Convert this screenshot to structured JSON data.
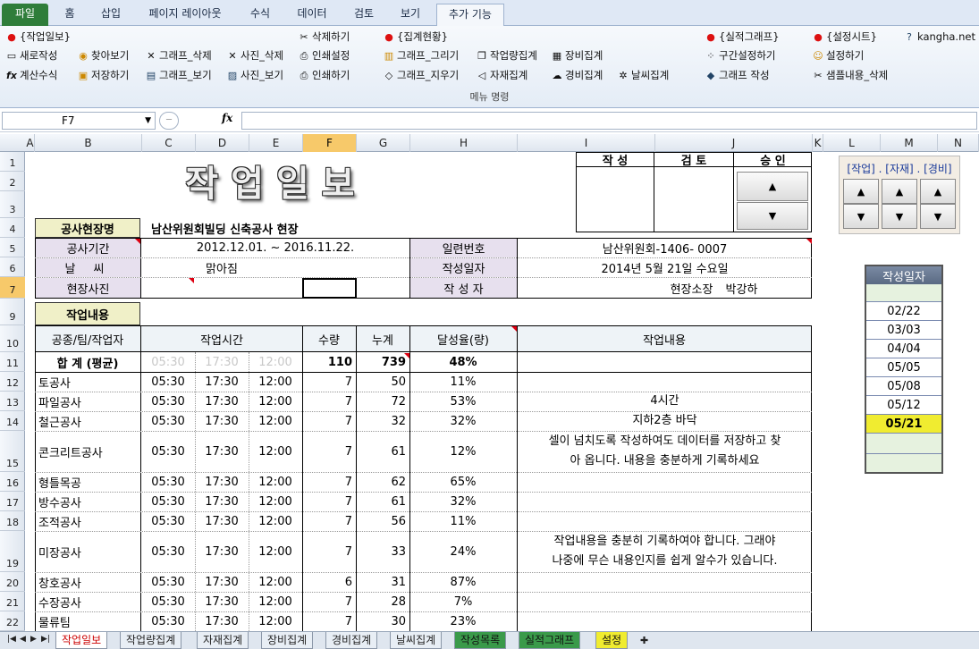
{
  "ribbon_tabs": [
    "파일",
    "홈",
    "삽입",
    "페이지 레이아웃",
    "수식",
    "데이터",
    "검토",
    "보기",
    "추가 기능"
  ],
  "ribbon": {
    "col1": [
      "{작업일보}",
      "새로작성",
      "계산수식"
    ],
    "col2": [
      "찾아보기",
      "저장하기"
    ],
    "col3": [
      "그래프_삭제",
      "그래프_보기"
    ],
    "col4": [
      "사진_삭제",
      "사진_보기"
    ],
    "col5": [
      "삭제하기",
      "인쇄설정",
      "인쇄하기"
    ],
    "col6": [
      "{집계현황}",
      "그래프_그리기",
      "그래프_지우기"
    ],
    "col7": [
      "작업량집계",
      "자재집계"
    ],
    "col8": [
      "장비집계",
      "경비집계"
    ],
    "col9": [
      "날씨집계"
    ],
    "col10": [
      "{실적그래프}",
      "구간설정하기",
      "그래프 작성"
    ],
    "col11": [
      "{설정시트}",
      "설정하기",
      "샘플내용_삭제"
    ],
    "site": "kangha.net",
    "group_label": "메뉴 명령"
  },
  "formula_bar": {
    "name_box": "F7",
    "fx": "fx",
    "value": ""
  },
  "columns": [
    "A",
    "B",
    "C",
    "D",
    "E",
    "F",
    "G",
    "H",
    "I",
    "J",
    "K",
    "L",
    "M",
    "N"
  ],
  "rows": [
    "1",
    "2",
    "3",
    "4",
    "5",
    "6",
    "7",
    "9",
    "10",
    "11",
    "12",
    "13",
    "14",
    "15",
    "16",
    "17",
    "18",
    "19",
    "20",
    "21",
    "22"
  ],
  "sheet": {
    "title": "작업일보",
    "approval": {
      "write": "작 성",
      "review": "검 토",
      "approve": "승 인"
    },
    "site_label": "공사현장명",
    "site_value": "남산위원회빌딩 신축공사 현장",
    "period_label": "공사기간",
    "period_value": "2012.12.01. ~ 2016.11.22.",
    "weather_label": "날 씨",
    "weather_value": "맑아짐",
    "photo_label": "현장사진",
    "serial_label": "일련번호",
    "serial_value": "남산위원회-1406- 0007",
    "date_label": "작성일자",
    "date_value": "2014년 5월 21일 수요일",
    "writer_label": "작 성 자",
    "writer_value": "현장소장 박강하",
    "work_label": "작업내용",
    "table_headers": {
      "trade": "공종/팀/작업자",
      "time": "작업시간",
      "qty": "수량",
      "cum": "누계",
      "rate": "달성율(량)",
      "content": "작업내용"
    },
    "total": {
      "label": "합 계 (평균)",
      "t1": "05:30",
      "t2": "17:30",
      "t3": "12:00",
      "qty": "110",
      "cum": "739",
      "rate": "48%"
    },
    "rows": [
      {
        "name": "토공사",
        "t1": "05:30",
        "t2": "17:30",
        "t3": "12:00",
        "qty": "7",
        "cum": "50",
        "rate": "11%",
        "content": ""
      },
      {
        "name": "파일공사",
        "t1": "05:30",
        "t2": "17:30",
        "t3": "12:00",
        "qty": "7",
        "cum": "72",
        "rate": "53%",
        "content": "4시간"
      },
      {
        "name": "철근공사",
        "t1": "05:30",
        "t2": "17:30",
        "t3": "12:00",
        "qty": "7",
        "cum": "32",
        "rate": "32%",
        "content": "지하2층 바닥"
      },
      {
        "name": "콘크리트공사",
        "t1": "05:30",
        "t2": "17:30",
        "t3": "12:00",
        "qty": "7",
        "cum": "61",
        "rate": "12%",
        "content": "셀이 넘치도록 작성하여도 데이터를 저장하고 찾",
        "content2": "아 옵니다. 내용을 충분하게 기록하세요"
      },
      {
        "name": "형틀목공",
        "t1": "05:30",
        "t2": "17:30",
        "t3": "12:00",
        "qty": "7",
        "cum": "62",
        "rate": "65%",
        "content": ""
      },
      {
        "name": "방수공사",
        "t1": "05:30",
        "t2": "17:30",
        "t3": "12:00",
        "qty": "7",
        "cum": "61",
        "rate": "32%",
        "content": ""
      },
      {
        "name": "조적공사",
        "t1": "05:30",
        "t2": "17:30",
        "t3": "12:00",
        "qty": "7",
        "cum": "56",
        "rate": "11%",
        "content": ""
      },
      {
        "name": "미장공사",
        "t1": "05:30",
        "t2": "17:30",
        "t3": "12:00",
        "qty": "7",
        "cum": "33",
        "rate": "24%",
        "content": "작업내용을 충분히 기록하여야 합니다. 그래야",
        "content2": "나중에 무슨 내용인지를 쉽게 알수가 있습니다."
      },
      {
        "name": "창호공사",
        "t1": "05:30",
        "t2": "17:30",
        "t3": "12:00",
        "qty": "6",
        "cum": "31",
        "rate": "87%",
        "content": ""
      },
      {
        "name": "수장공사",
        "t1": "05:30",
        "t2": "17:30",
        "t3": "12:00",
        "qty": "7",
        "cum": "28",
        "rate": "7%",
        "content": ""
      },
      {
        "name": "물류팀",
        "t1": "05:30",
        "t2": "17:30",
        "t3": "12:00",
        "qty": "7",
        "cum": "30",
        "rate": "23%",
        "content": ""
      }
    ],
    "nav_panel": {
      "label": "[작업] . [자재] . [경비]",
      "up": "▲",
      "down": "▼"
    },
    "date_list": {
      "header": "작성일자",
      "dates": [
        "02/22",
        "03/03",
        "04/04",
        "05/05",
        "05/08",
        "05/12",
        "05/21"
      ],
      "selected": "05/21"
    }
  },
  "sheet_tabs": [
    "작업일보",
    "작업량집계",
    "자재집계",
    "장비집계",
    "경비집계",
    "날씨집계",
    "작성목록",
    "실적그래프",
    "설정"
  ]
}
